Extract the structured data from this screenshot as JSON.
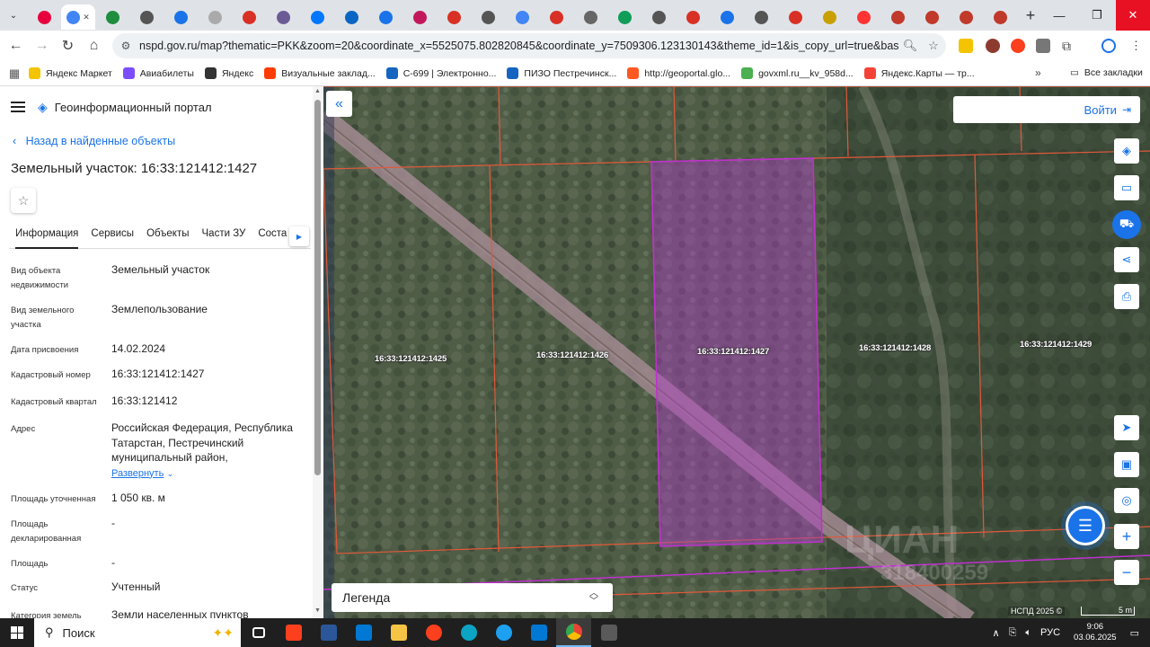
{
  "browser": {
    "url": "nspd.gov.ru/map?thematic=PKK&zoom=20&coordinate_x=5525075.802820845&coordinate_y=7509306.123130143&theme_id=1&is_copy_url=true&baseLayerId=363...",
    "tab_favicon_colors": [
      "#e8003d",
      "#4285f4",
      "#1e8e3e",
      "#555555",
      "#1a73e8",
      "#aaaaaa",
      "#d93025",
      "#6b5b95",
      "#0077ff",
      "#0a66c2",
      "#1a73e8",
      "#c2185b",
      "#d93025",
      "#555555",
      "#4285f4",
      "#d93025",
      "#666666",
      "#0f9d58",
      "#555555",
      "#d93025",
      "#1a73e8",
      "#555555",
      "#d93025",
      "#c9a000",
      "#ff3333",
      "#c0392b",
      "#c0392b",
      "#c0392b",
      "#c0392b"
    ],
    "bookmarks": [
      {
        "label": "Яндекс Маркет",
        "color": "#f4c400"
      },
      {
        "label": "Авиабилеты",
        "color": "#7c4dff"
      },
      {
        "label": "Яндекс",
        "color": "#333333"
      },
      {
        "label": "Визуальные заклад...",
        "color": "#ff3d00"
      },
      {
        "label": "С-699 | Электронно...",
        "color": "#1565c0"
      },
      {
        "label": "ПИЗО Пестречинск...",
        "color": "#1565c0"
      },
      {
        "label": "http://geoportal.glo...",
        "color": "#ff5722"
      },
      {
        "label": "govxml.ru__kv_958d...",
        "color": "#4caf50"
      },
      {
        "label": "Яндекс.Карты — тр...",
        "color": "#f44336"
      }
    ],
    "bookmarks_more": "»",
    "all_bookmarks": "Все закладки"
  },
  "panel": {
    "portal_name": "Геоинформационный портал",
    "back_link": "Назад в найденные объекты",
    "title": "Земельный участок: 16:33:121412:1427",
    "tabs": [
      "Информация",
      "Сервисы",
      "Объекты",
      "Части ЗУ",
      "Соста"
    ],
    "fields": [
      {
        "label": "Вид объекта недвижимости",
        "value": "Земельный участок"
      },
      {
        "label": "Вид земельного участка",
        "value": "Землепользование"
      },
      {
        "label": "Дата присвоения",
        "value": "14.02.2024"
      },
      {
        "label": "Кадастровый номер",
        "value": "16:33:121412:1427"
      },
      {
        "label": "Кадастровый квартал",
        "value": "16:33:121412"
      },
      {
        "label": "Адрес",
        "value": "Российская Федерация, Республика Татарстан, Пестречинский муниципальный район,"
      },
      {
        "label": "Площадь уточненная",
        "value": "1 050 кв. м"
      },
      {
        "label": "Площадь декларированная",
        "value": "-"
      },
      {
        "label": "Площадь",
        "value": "-"
      },
      {
        "label": "Статус",
        "value": "Учтенный"
      },
      {
        "label": "Категория земель",
        "value": "Земли населенных пунктов"
      }
    ],
    "expand_label": "Развернуть"
  },
  "map": {
    "login_label": "Войти",
    "legend_label": "Легенда",
    "attribution": "НСПД 2025 ©",
    "scale_label": "5 m",
    "watermark": "ЦИАН",
    "watermark_id": "318400259",
    "parcels": [
      {
        "label": "16:33:121412:1425"
      },
      {
        "label": "16:33:121412:1426"
      },
      {
        "label": "16:33:121412:1427",
        "selected": true
      },
      {
        "label": "16:33:121412:1428"
      },
      {
        "label": "16:33:121412:1429"
      }
    ],
    "colors": {
      "parcel_border": "#e2593a",
      "selected_fill": "#b03cc8",
      "selected_border": "#c030d0",
      "accent": "#1a73e8"
    }
  },
  "taskbar": {
    "search_label": "Поиск",
    "language": "РУС",
    "time": "9:06",
    "date": "03.06.2025"
  }
}
